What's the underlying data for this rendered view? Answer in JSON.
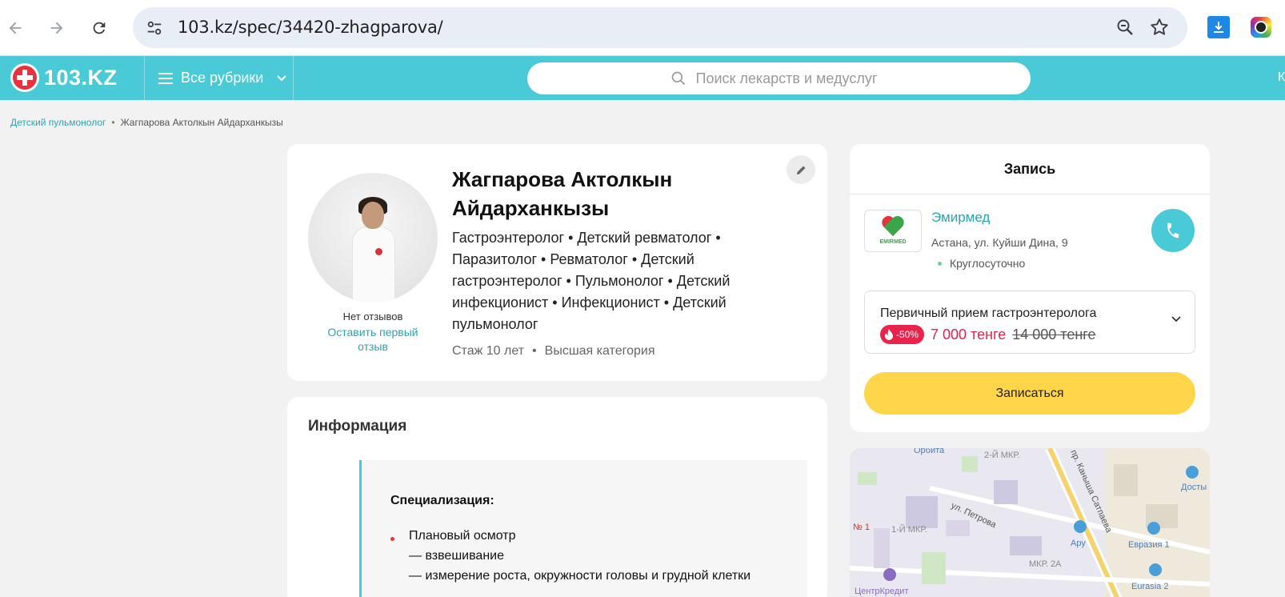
{
  "browser": {
    "url": "103.kz/spec/34420-zhagparova/",
    "icons": [
      "back-icon",
      "forward-icon",
      "reload-icon",
      "site-settings-icon",
      "zoom-icon",
      "bookmark-star-icon",
      "download-icon",
      "extension-icon"
    ]
  },
  "header": {
    "logo_text": "103.KZ",
    "rubrics_label": "Все рубрики",
    "search_placeholder": "Поиск лекарств и медуслуг",
    "edge_text": "К",
    "brand_color": "#4acad6"
  },
  "breadcrumb": {
    "items": [
      {
        "label": "Детский пульмонолог"
      },
      {
        "label": "Жагпарова Актолкын Айдарханкызы"
      }
    ]
  },
  "profile": {
    "name": "Жагпарова Актолкын Айдарханкызы",
    "specialties": "Гастроэнтеролог • Детский ревматолог • Паразитолог • Ревматолог • Детский гастроэнтеролог • Пульмонолог • Детский инфекционист • Инфекционист • Детский пульмонолог",
    "experience": "Стаж 10 лет",
    "category": "Высшая категория",
    "no_reviews": "Нет отзывов",
    "leave_review": "Оставить первый отзыв"
  },
  "info": {
    "title": "Информация",
    "spec_heading": "Специализация:",
    "lines": [
      "Плановый осмотр",
      "— взвешивание",
      "— измерение роста, окружности головы и грудной клетки"
    ]
  },
  "booking": {
    "title": "Запись",
    "clinic": {
      "name": "Эмирмед",
      "logo_text": "EMIRMED",
      "address": "Астана, ул. Куйши Дина, 9",
      "hours": "Круглосуточно"
    },
    "service": {
      "name": "Первичный прием гастроэнтеролога",
      "discount": "-50%",
      "price_new": "7 000 тенге",
      "price_old": "14 000 тенге"
    },
    "button": "Записаться",
    "button_color": "#ffd54a",
    "accent_price_color": "#e8244c"
  },
  "map": {
    "labels": {
      "l1": "Орбита",
      "l2": "2-Й МКР.",
      "l3": "ул. Петрова",
      "l4": "1-Й МКР.",
      "l5": "№ 1",
      "l6": "Ару",
      "l7": "Евразия 1",
      "l8": "МКР. 2А",
      "l9": "Eurasia 2",
      "l10": "ЦентрКредит",
      "l11": "Досты",
      "l12": "пр. Каныша Сатпаева"
    }
  }
}
